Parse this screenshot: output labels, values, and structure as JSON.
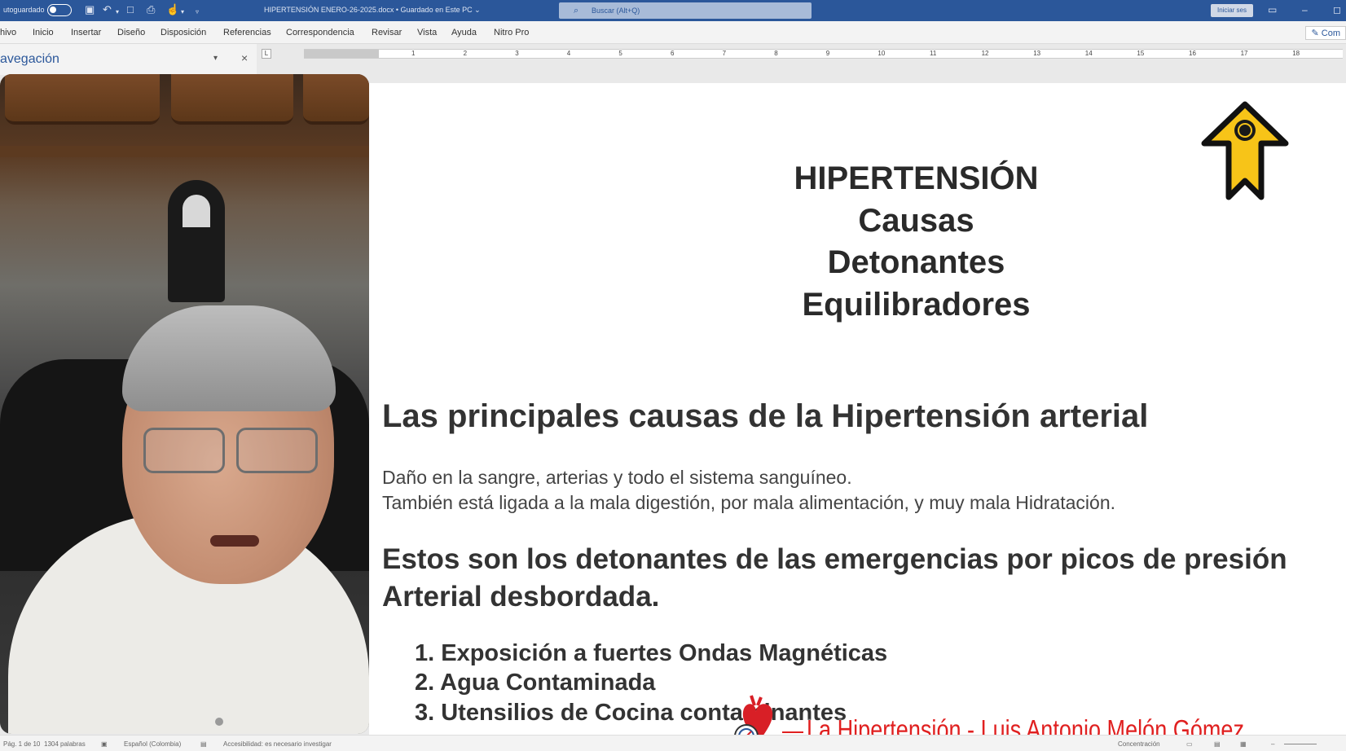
{
  "titlebar": {
    "autosave_label": "utoguardado",
    "document_title": "HIPERTENSIÓN ENERO-26-2025.docx • Guardado en Este PC ⌄",
    "search_placeholder": "Buscar (Alt+Q)",
    "signin_label": "Iniciar ses"
  },
  "menu": {
    "items": [
      "hivo",
      "Inicio",
      "Insertar",
      "Diseño",
      "Disposición",
      "Referencias",
      "Correspondencia",
      "Revisar",
      "Vista",
      "Ayuda",
      "Nitro Pro"
    ],
    "comments_label": "Com"
  },
  "nav_pane": {
    "title": "avegación"
  },
  "ruler": {
    "numbers": [
      "1",
      "2",
      "3",
      "4",
      "5",
      "6",
      "7",
      "8",
      "9",
      "10",
      "11",
      "12",
      "13",
      "14",
      "15",
      "16",
      "17",
      "18"
    ]
  },
  "document": {
    "title_lines": [
      "HIPERTENSIÓN",
      "Causas",
      "Detonantes",
      "Equilibradores"
    ],
    "heading_causes": "Las principales causas de la Hipertensión arterial",
    "body_lines": [
      "Daño en la sangre, arterias y todo el sistema sanguíneo.",
      "También está ligada a la mala digestión, por mala alimentación, y muy mala Hidratación."
    ],
    "heading_triggers": "Estos son los detonantes de las emergencias por picos de presión Arterial desbordada.",
    "list_items": [
      "1.  Exposición a fuertes Ondas Magnéticas",
      "2.  Agua Contaminada",
      "3.  Utensilios de Cocina contaminantes"
    ]
  },
  "watermark": {
    "text": "La Hipertensión - Luis Antonio Melón Gómez"
  },
  "statusbar": {
    "page": "Pág. 1 de 10",
    "words": "1304 palabras",
    "language": "Español (Colombia)",
    "accessibility": "Accesibilidad: es necesario investigar",
    "focus": "Concentración"
  },
  "colors": {
    "word_blue": "#2b579a",
    "watermark_red": "#e02020",
    "arrow_yellow": "#f7c418"
  },
  "icons": {
    "arrow_logo": "yellow-up-arrow-logo-icon",
    "heart_logo": "heart-gauge-icon"
  }
}
